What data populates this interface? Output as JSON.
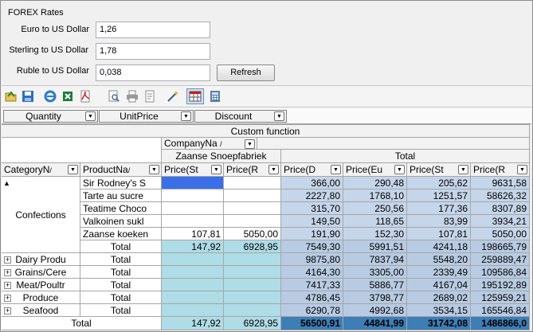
{
  "forex": {
    "title": "FOREX Rates",
    "euro_label": "Euro to US Dollar",
    "euro_value": "1,26",
    "sterling_label": "Sterling to US Dollar",
    "sterling_value": "1,78",
    "ruble_label": "Ruble to US Dollar",
    "ruble_value": "0,038",
    "refresh_label": "Refresh"
  },
  "toolbar": [
    "open-folder-icon",
    "save-icon",
    "internet-explorer-icon",
    "excel-export-icon",
    "pdf-export-icon",
    "print-preview-icon",
    "print-icon",
    "page-setup-icon",
    "chart-wizard-icon",
    "grid-view-icon",
    "calculator-icon"
  ],
  "filter_fields": [
    "Quantity",
    "UnitPrice",
    "Discount"
  ],
  "grid": {
    "custom_function": "Custom function",
    "column_field": "CompanyNa",
    "zaanse": "Zaanse Snoepfabriek",
    "total": "Total",
    "row_fields": [
      "CategoryN",
      "ProductNa"
    ],
    "measure_headers": [
      "Price(St",
      "Price(R",
      "Price(D",
      "Price(Eu",
      "Price(St",
      "Price(R"
    ],
    "confections": "Confections",
    "products": [
      {
        "name": "Sir Rodney's S",
        "z_st": "",
        "z_r": "",
        "d": "366,00",
        "eu": "290,48",
        "st": "205,62",
        "r": "9631,58"
      },
      {
        "name": "Tarte au sucre",
        "z_st": "",
        "z_r": "",
        "d": "2227,80",
        "eu": "1768,10",
        "st": "1251,57",
        "r": "58626,32"
      },
      {
        "name": "Teatime Choco",
        "z_st": "",
        "z_r": "",
        "d": "315,70",
        "eu": "250,56",
        "st": "177,36",
        "r": "8307,89"
      },
      {
        "name": "Valkoinen sukl",
        "z_st": "",
        "z_r": "",
        "d": "149,50",
        "eu": "118,65",
        "st": "83,99",
        "r": "3934,21"
      },
      {
        "name": "Zaanse koeken",
        "z_st": "107,81",
        "z_r": "5050,00",
        "d": "191,90",
        "eu": "152,30",
        "st": "107,81",
        "r": "5050,00"
      },
      {
        "name": "Total",
        "z_st": "147,92",
        "z_r": "6928,95",
        "d": "7549,30",
        "eu": "5991,51",
        "st": "4241,18",
        "r": "198665,79"
      }
    ],
    "categories": [
      {
        "name": "Dairy Produ",
        "sub": "Total",
        "d": "9875,80",
        "eu": "7837,94",
        "st": "5548,20",
        "r": "259889,47"
      },
      {
        "name": "Grains/Cere",
        "sub": "Total",
        "d": "4164,30",
        "eu": "3305,00",
        "st": "2339,49",
        "r": "109586,84"
      },
      {
        "name": "Meat/Poultr",
        "sub": "Total",
        "d": "7417,33",
        "eu": "5886,77",
        "st": "4167,04",
        "r": "195192,89"
      },
      {
        "name": "Produce",
        "sub": "Total",
        "d": "4786,45",
        "eu": "3798,77",
        "st": "2689,02",
        "r": "125959,21"
      },
      {
        "name": "Seafood",
        "sub": "Total",
        "d": "6290,78",
        "eu": "4992,68",
        "st": "3534,15",
        "r": "165546,84"
      }
    ],
    "grand": {
      "label": "Total",
      "z_st": "147,92",
      "z_r": "6928,95",
      "d": "56500,91",
      "eu": "44841,99",
      "st": "31742,08",
      "r": "1486866,0"
    }
  }
}
